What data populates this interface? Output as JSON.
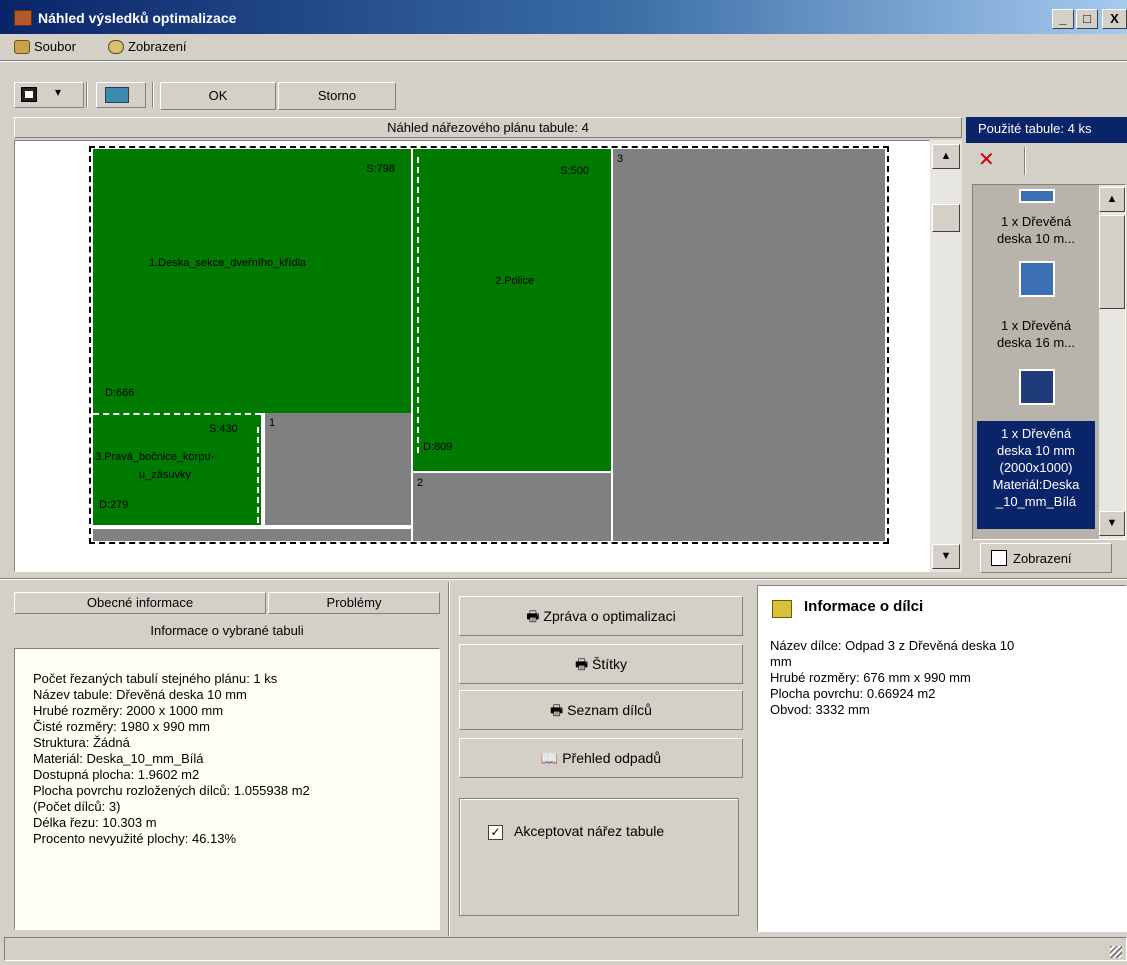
{
  "window": {
    "title": "Náhled výsledků optimalizace",
    "min": "_",
    "max": "□",
    "close": "X"
  },
  "menu": [
    {
      "label": "Soubor",
      "icon": "file-cabinet-icon"
    },
    {
      "label": "Zobrazení",
      "icon": "view-gear-icon"
    }
  ],
  "toolbar": {
    "ok_label": "OK",
    "cancel_label": "Storno",
    "dropdown_glyph": "▾"
  },
  "preview": {
    "header": "Náhled nářezového plánu tabule: 4",
    "parts": [
      {
        "name": "1.Deska_sekce_dveřního_křídla",
        "s": "S:798",
        "d": "D:666"
      },
      {
        "name": "2.Police",
        "s": "S:500",
        "d": "D:809"
      },
      {
        "name": "3.Pravá_bočnice_korpu-u_zásuvky",
        "name_line1": "3.Pravá_bočnice_korpu-",
        "name_line2": "u_zásuvky",
        "s": "S:430",
        "d": "D:279"
      }
    ],
    "waste_labels": [
      "1",
      "2",
      "3"
    ]
  },
  "used_sheets": {
    "header": "Použité tabule: 4 ks",
    "items": [
      {
        "line1": "1 x Dřevěná",
        "line2": "deska 10 m..."
      },
      {
        "line1": "1 x Dřevěná",
        "line2": "deska 16 m..."
      },
      {
        "line1": "1 x Dřevěná",
        "line2": "deska 10 mm",
        "line3": "(2000x1000)",
        "line4": "Materiál:Deska",
        "line5": "_10_mm_Bílá"
      }
    ],
    "view_button": "Zobrazení"
  },
  "tabs": {
    "general": "Obecné informace",
    "problems": "Problémy",
    "selected_info_title": "Informace o vybrané tabuli"
  },
  "sheet_info": [
    "Počet řezaných tabulí stejného plánu: 1 ks",
    "Název tabule: Dřevěná deska 10 mm",
    "Hrubé rozměry: 2000 x 1000 mm",
    "Čisté rozměry: 1980 x 990 mm",
    "Struktura: Žádná",
    "Materiál: Deska_10_mm_Bílá",
    "Dostupná plocha: 1.9602 m2",
    "Plocha povrchu rozložených dílců: 1.055938 m2",
    "(Počet dílců: 3)",
    "Délka řezu: 10.303 m",
    "Procento nevyužité plochy: 46.13%"
  ],
  "actions": {
    "report": "Zpráva o optimalizaci",
    "labels": "Štítky",
    "parts_list": "Seznam dílců",
    "waste_overview": "Přehled odpadů",
    "accept_label": "Akceptovat nářez tabule",
    "accept_checked": true
  },
  "part_info": {
    "title": "Informace o dílci",
    "lines": [
      "Název dílce: Odpad 3 z Dřevěná deska 10",
      "mm",
      "Hrubé rozměry: 676 mm x 990 mm",
      "Plocha povrchu: 0.66924 m2",
      "Obvod: 3332 mm"
    ]
  },
  "colors": {
    "part": "#007a00",
    "waste": "#808080",
    "selection": "#0a246a"
  }
}
